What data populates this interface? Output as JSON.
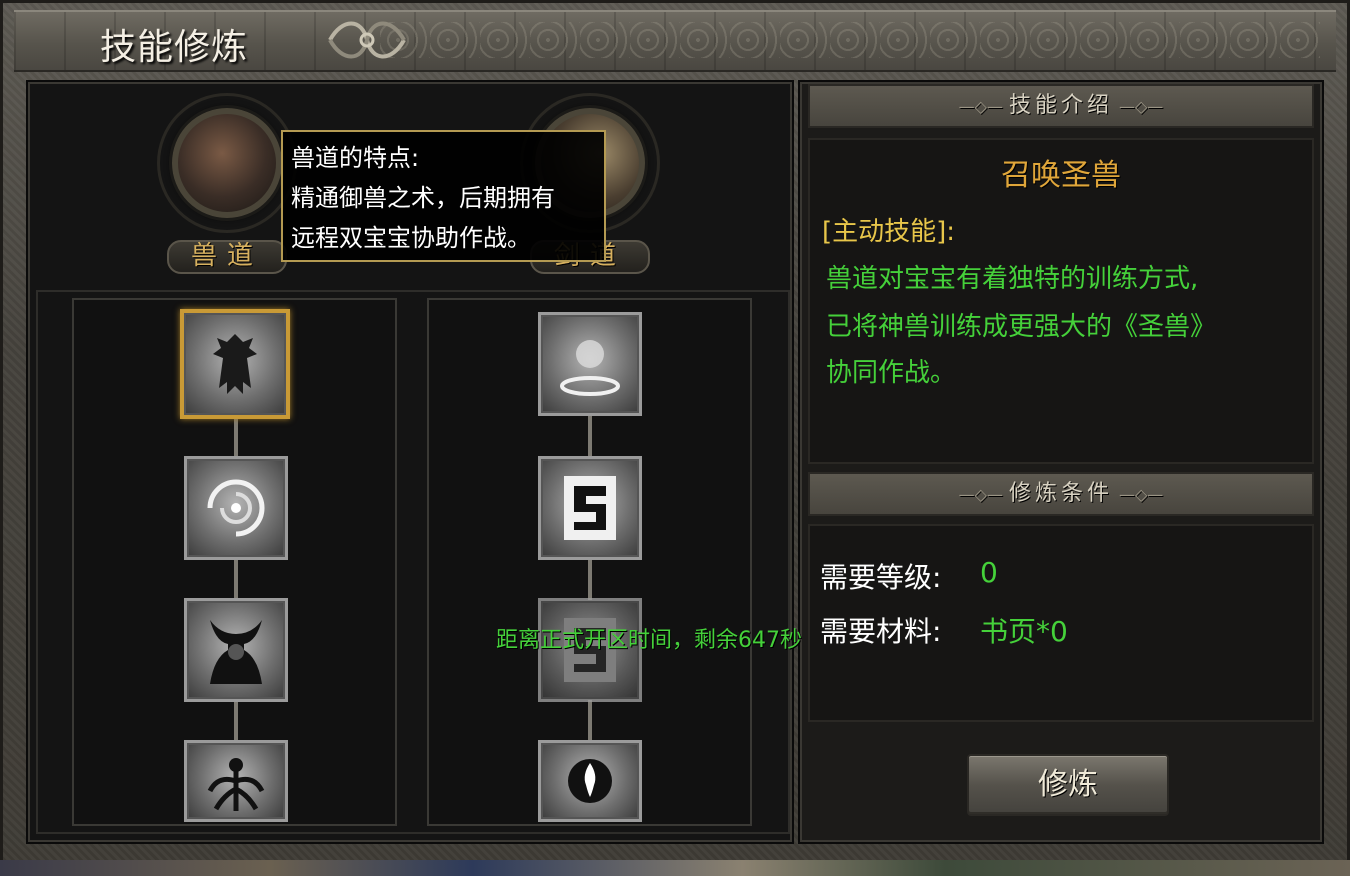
{
  "window": {
    "title": "技能修炼"
  },
  "classes": [
    {
      "name": "兽道"
    },
    {
      "name": "剑道"
    }
  ],
  "tooltip": {
    "heading": "兽道的特点:",
    "line1": "精通御兽之术，后期拥有",
    "line2": "远程双宝宝协助作战。"
  },
  "skill_trees": {
    "left": [
      "summon-beast-icon",
      "vortex-icon",
      "horned-helm-icon",
      "tentacle-beast-icon"
    ],
    "right": [
      "halo-burst-icon",
      "seal-rune-icon",
      "seal-rune-icon",
      "flame-orb-icon"
    ]
  },
  "skill_intro": {
    "header": "技能介绍",
    "skill_name": "召唤圣兽",
    "skill_type": "[主动技能]:",
    "description": [
      "兽道对宝宝有着独特的训练方式,",
      "已将神兽训练成更强大的《圣兽》",
      "协同作战。"
    ]
  },
  "requirements": {
    "header": "修炼条件",
    "level_label": "需要等级:",
    "level_value": "0",
    "material_label": "需要材料:",
    "material_value": "书页*0"
  },
  "train_button": "修炼",
  "notice": "距离正式开区时间，剩余647秒",
  "colors": {
    "green_text": "#45d13a",
    "gold_text": "#e0a63a",
    "selected_border": "#c99a36"
  }
}
